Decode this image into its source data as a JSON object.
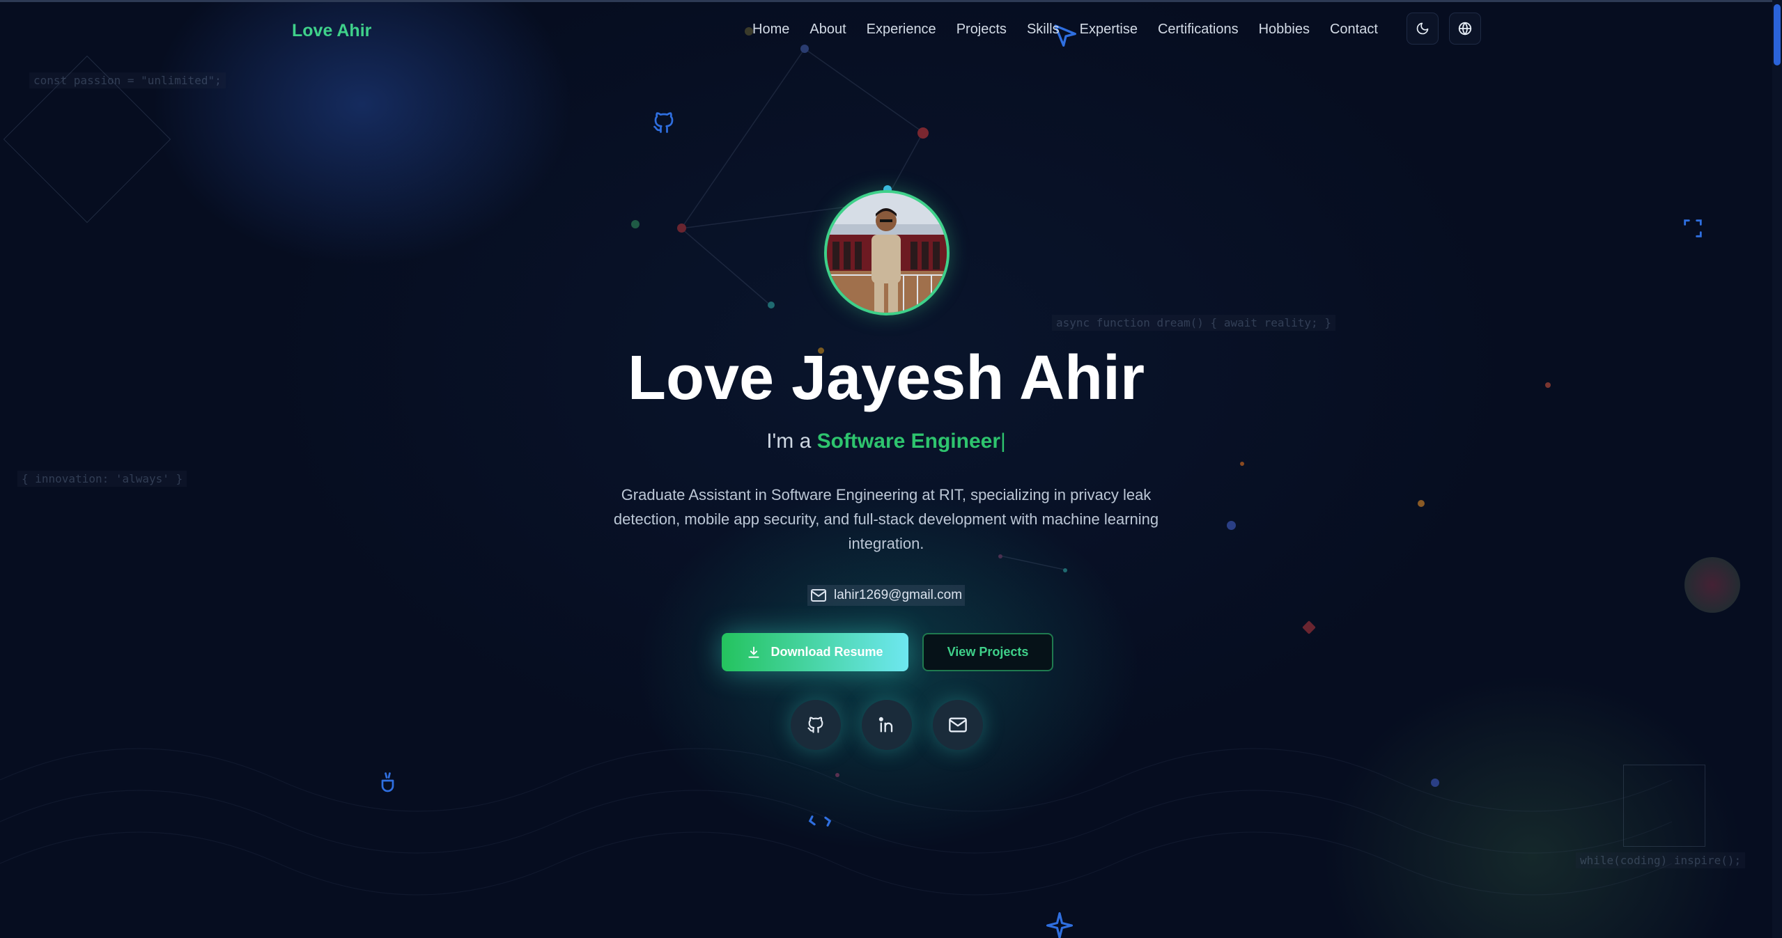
{
  "nav": {
    "logo": "Love Ahir",
    "links": [
      "Home",
      "About",
      "Experience",
      "Projects",
      "Skills",
      "Expertise",
      "Certifications",
      "Hobbies",
      "Contact"
    ],
    "theme_toggle_icon": "moon-icon",
    "language_icon": "globe-icon"
  },
  "hero": {
    "name": "Love Jayesh Ahir",
    "tagline_prefix": "I'm a",
    "role": "Software Engineer",
    "caret": "|",
    "bio": "Graduate Assistant in Software Engineering at RIT, specializing in privacy leak detection, mobile app security, and full-stack development with machine learning integration.",
    "email": "lahir1269@gmail.com",
    "download_resume": "Download Resume",
    "view_projects": "View Projects",
    "social_icons": [
      "github-icon",
      "linkedin-icon",
      "mail-icon"
    ]
  },
  "background": {
    "code_snippets": [
      "const passion = \"unlimited\";",
      "async function dream() { await reality; }",
      "{ innovation: 'always' }",
      "while(coding) inspire();"
    ]
  },
  "colors": {
    "accent_green": "#3fd18a",
    "role_green": "#2ec46e",
    "background": "#060d20",
    "button_gradient_end": "#6ee7f0"
  }
}
